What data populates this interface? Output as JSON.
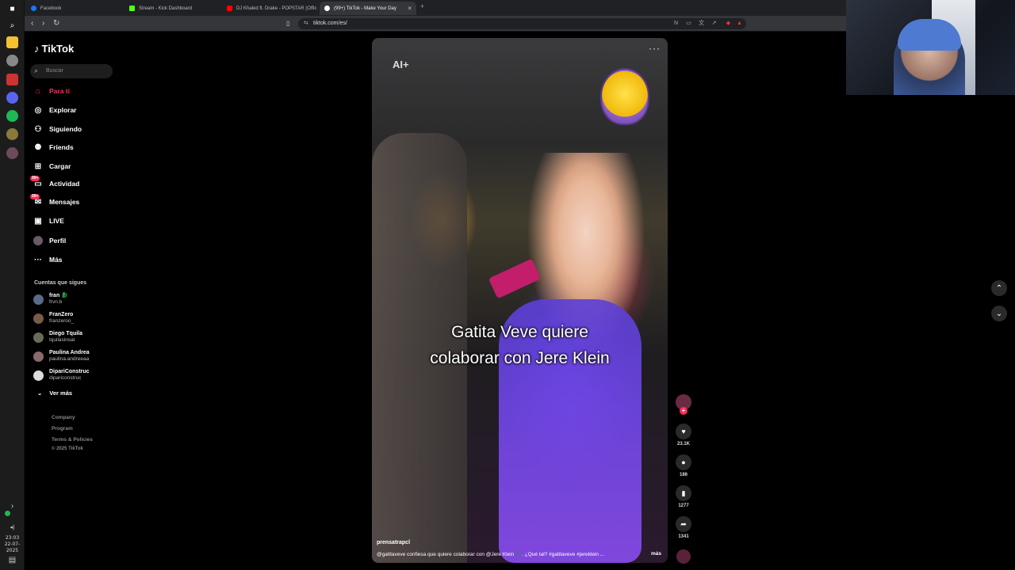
{
  "browser": {
    "tabs": [
      {
        "title": "Facebook",
        "color": "#1877f2",
        "active": false
      },
      {
        "title": "Stream - Kick Dashboard",
        "color": "#53fc18",
        "active": false
      },
      {
        "title": "DJ Khaled ft. Drake - POPSTAR (Offic",
        "color": "#ff0000",
        "active": false
      },
      {
        "title": "(99+) TikTok - Make Your Day",
        "color": "#ffffff",
        "active": true
      }
    ],
    "url": "tiktok.com/es/"
  },
  "taskbar": {
    "clock_time": "23:03",
    "clock_date": "22-07-2025"
  },
  "tiktok": {
    "logo": "TikTok",
    "search_placeholder": "Buscar",
    "nav": [
      {
        "label": "Para ti",
        "icon": "home-icon",
        "active": true
      },
      {
        "label": "Explorar",
        "icon": "compass-icon"
      },
      {
        "label": "Siguiendo",
        "icon": "following-icon"
      },
      {
        "label": "Friends",
        "icon": "friends-icon"
      },
      {
        "label": "Cargar",
        "icon": "upload-icon"
      },
      {
        "label": "Actividad",
        "icon": "activity-icon",
        "badge": "99+"
      },
      {
        "label": "Mensajes",
        "icon": "messages-icon",
        "badge": "99+"
      },
      {
        "label": "LIVE",
        "icon": "live-icon"
      },
      {
        "label": "Perfil",
        "icon": "profile-icon"
      },
      {
        "label": "Más",
        "icon": "more-icon"
      }
    ],
    "following_title": "Cuentas que sigues",
    "following": [
      {
        "name": "fran 🐉",
        "handle": "frvn.b"
      },
      {
        "name": "FranZero",
        "handle": "franzeroo_"
      },
      {
        "name": "Diego Tquila",
        "handle": "tquilasinsal"
      },
      {
        "name": "Paulina Andrea",
        "handle": "paulina.andreeaa"
      },
      {
        "name": "DipariConstruc",
        "handle": "dipariconstruc"
      }
    ],
    "see_more": "Ver más",
    "footer": [
      "Company",
      "Program",
      "Terms & Policies",
      "© 2025 TikTok"
    ]
  },
  "video": {
    "ai_label": "AI+",
    "caption_line1": "Gatita Veve quiere",
    "caption_line2": "colaborar con Jere Klein",
    "author": "prensatrapcl",
    "description": "@gatitaveve confiesa que quiere colaborar con @Jere Klein 🎼. ¿Qué tal? #gatitaveve #jereklein ...",
    "more_label": "más",
    "likes": "23.1K",
    "comments": "186",
    "saves": "1277",
    "shares": "1341"
  }
}
